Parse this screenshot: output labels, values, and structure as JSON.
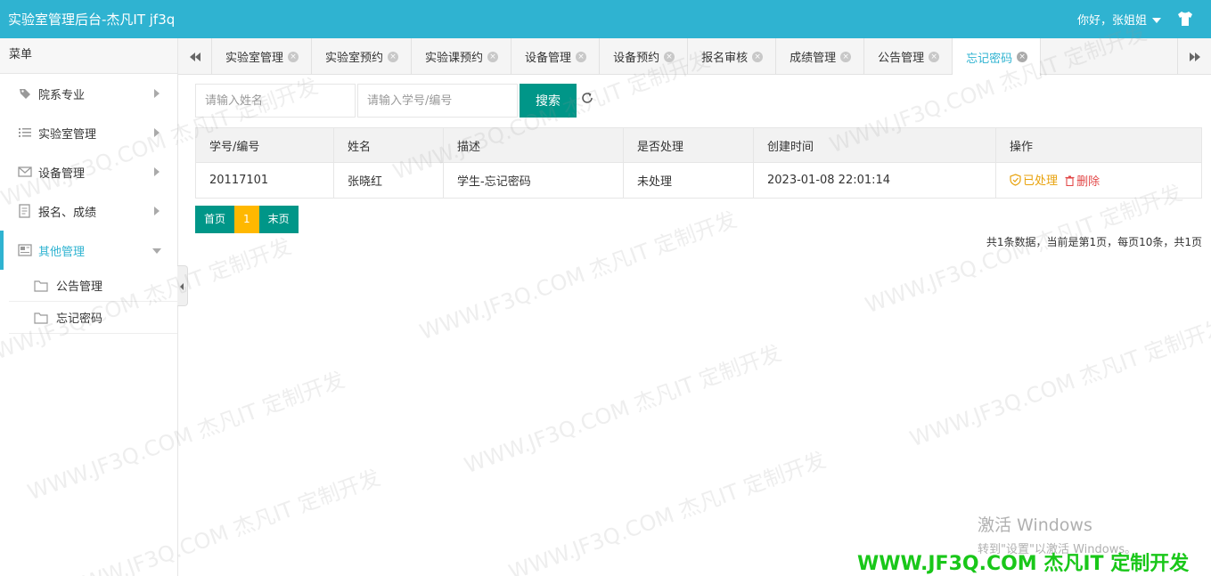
{
  "header": {
    "title": "实验室管理后台-杰凡IT jf3q",
    "greeting": "你好，张姐姐"
  },
  "sidebar": {
    "menu_title": "菜单",
    "items": [
      {
        "label": "院系专业",
        "icon": "tag-icon"
      },
      {
        "label": "实验室管理",
        "icon": "list-icon"
      },
      {
        "label": "设备管理",
        "icon": "mail-icon"
      },
      {
        "label": "报名、成绩",
        "icon": "document-icon"
      },
      {
        "label": "其他管理",
        "icon": "newspaper-icon"
      }
    ],
    "sub_items": [
      {
        "label": "公告管理",
        "icon": "folder-icon"
      },
      {
        "label": "忘记密码",
        "icon": "folder-icon"
      }
    ]
  },
  "tabs": [
    {
      "label": "实验室管理"
    },
    {
      "label": "实验室预约"
    },
    {
      "label": "实验课预约"
    },
    {
      "label": "设备管理"
    },
    {
      "label": "设备预约"
    },
    {
      "label": "报名审核"
    },
    {
      "label": "成绩管理"
    },
    {
      "label": "公告管理"
    },
    {
      "label": "忘记密码"
    }
  ],
  "search": {
    "name_placeholder": "请输入姓名",
    "id_placeholder": "请输入学号/编号",
    "button_label": "搜索"
  },
  "table": {
    "headers": [
      "学号/编号",
      "姓名",
      "描述",
      "是否处理",
      "创建时间",
      "操作"
    ],
    "rows": [
      {
        "id": "20117101",
        "name": "张晓红",
        "description": "学生-忘记密码",
        "status": "未处理",
        "created": "2023-01-08 22:01:14",
        "action_done": "已处理",
        "action_delete": "删除"
      }
    ]
  },
  "pager": {
    "first": "首页",
    "current": "1",
    "last": "末页",
    "summary": "共1条数据，当前是第1页，每页10条，共1页"
  },
  "overlay": {
    "activate_title": "激活 Windows",
    "activate_sub": "转到\"设置\"以激活 Windows。",
    "brand": "WWW.JF3Q.COM 杰凡IT  定制开发",
    "watermark": "WWW.JF3Q.COM 杰凡IT  定制开发"
  },
  "colors": {
    "header": "#2fb3d1",
    "primary_button": "#009688",
    "pager_current": "#ffb800",
    "action_done": "#e8a20c",
    "action_delete": "#e24848",
    "brand": "#19c719"
  }
}
